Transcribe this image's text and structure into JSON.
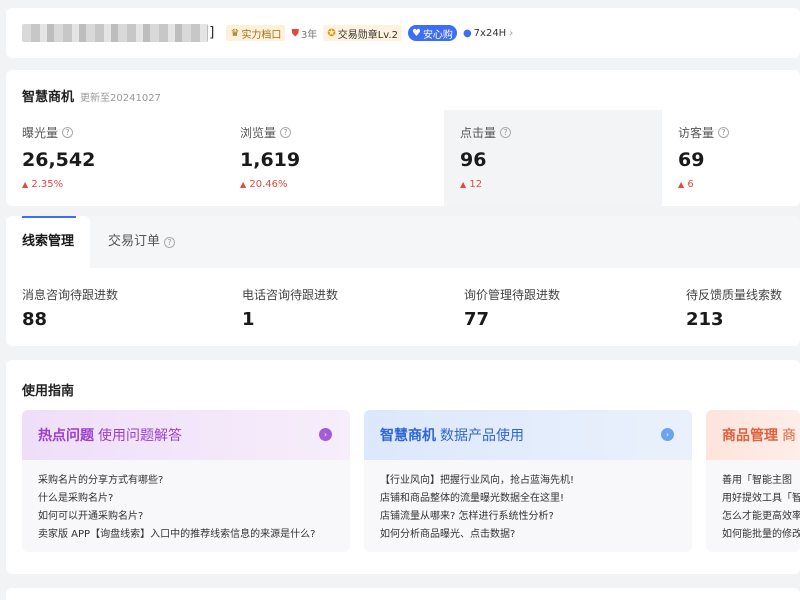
{
  "header": {
    "bracket": "]",
    "badges": {
      "strength": "实力档口",
      "years": "3年",
      "medal": "交易勋章Lv.2",
      "assure": "安心购",
      "service": "7x24H"
    }
  },
  "metrics": {
    "title": "智慧商机",
    "updated": "更新至20241027",
    "items": [
      {
        "label": "曝光量",
        "value": "26,542",
        "delta": "2.35%"
      },
      {
        "label": "浏览量",
        "value": "1,619",
        "delta": "20.46%"
      },
      {
        "label": "点击量",
        "value": "96",
        "delta": "12"
      },
      {
        "label": "访客量",
        "value": "69",
        "delta": "6"
      }
    ]
  },
  "leads": {
    "tabs": [
      "线索管理",
      "交易订单"
    ],
    "items": [
      {
        "label": "消息咨询待跟进数",
        "value": "88"
      },
      {
        "label": "电话咨询待跟进数",
        "value": "1"
      },
      {
        "label": "询价管理待跟进数",
        "value": "77"
      },
      {
        "label": "待反馈质量线索数",
        "value": "213"
      }
    ]
  },
  "guide": {
    "title": "使用指南",
    "cards": [
      {
        "title": "热点问题",
        "subtitle": "使用问题解答",
        "items": [
          "采购名片的分享方式有哪些?",
          "什么是采购名片?",
          "如何可以开通采购名片?",
          "卖家版 APP【询盘线索】入口中的推荐线索信息的来源是什么?"
        ]
      },
      {
        "title": "智慧商机",
        "subtitle": "数据产品使用",
        "items": [
          "【行业风向】把握行业风向，抢占蓝海先机!",
          "店铺和商品整体的流量曝光数据全在这里!",
          "店铺流量从哪来? 怎样进行系统性分析?",
          "如何分析商品曝光、点击数据?"
        ]
      },
      {
        "title": "商品管理",
        "subtitle": "商",
        "items": [
          "善用「智能主图",
          "用好提效工具「智",
          "怎么才能更高效率",
          "如何能批量的修改"
        ]
      }
    ]
  },
  "icons": {
    "question": "?",
    "arrow": "›",
    "up": "▲"
  }
}
